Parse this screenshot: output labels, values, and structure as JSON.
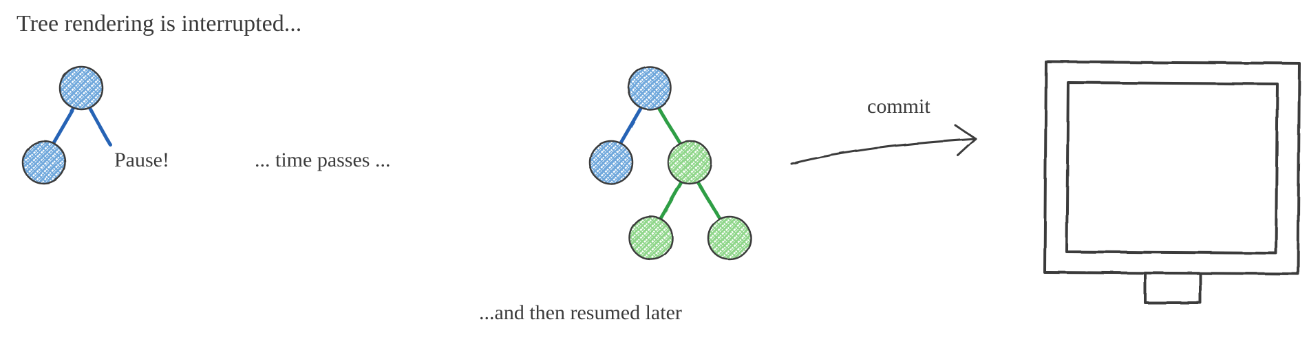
{
  "title": "Tree rendering is interrupted...",
  "labels": {
    "pause": "Pause!",
    "time_passes": "... time passes ...",
    "resumed": "...and then resumed later",
    "commit": "commit"
  },
  "colors": {
    "blue_stroke": "#2563b5",
    "blue_fill": "#6fa8dc",
    "green_stroke": "#2e9e44",
    "green_fill": "#74c76f",
    "ink": "#3b3b3b"
  },
  "trees": {
    "left": {
      "nodes": [
        {
          "id": "l-root",
          "color": "blue"
        },
        {
          "id": "l-left",
          "color": "blue"
        }
      ],
      "edges": [
        {
          "from": "l-root",
          "to": "l-left",
          "color": "blue"
        },
        {
          "from": "l-root",
          "to": "l-right-stub",
          "color": "blue"
        }
      ]
    },
    "right": {
      "nodes": [
        {
          "id": "r-root",
          "color": "blue"
        },
        {
          "id": "r-left",
          "color": "blue"
        },
        {
          "id": "r-right",
          "color": "green"
        },
        {
          "id": "r-gl",
          "color": "green"
        },
        {
          "id": "r-gr",
          "color": "green"
        }
      ],
      "edges": [
        {
          "from": "r-root",
          "to": "r-left",
          "color": "blue"
        },
        {
          "from": "r-root",
          "to": "r-right",
          "color": "green"
        },
        {
          "from": "r-right",
          "to": "r-gl",
          "color": "green"
        },
        {
          "from": "r-right",
          "to": "r-gr",
          "color": "green"
        }
      ]
    }
  }
}
